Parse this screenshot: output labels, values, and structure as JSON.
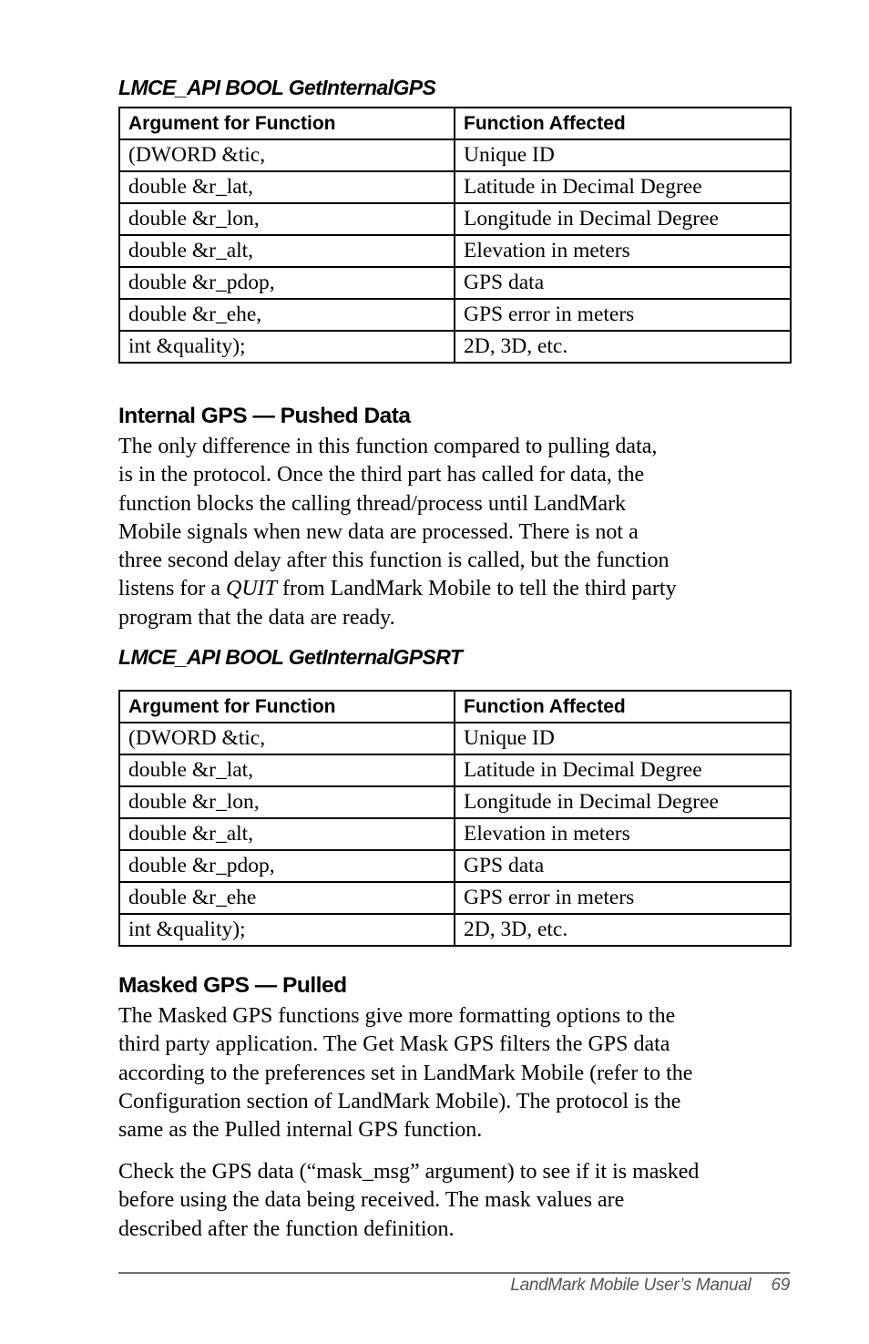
{
  "section1": {
    "function_title": "LMCE_API BOOL GetInternalGPS",
    "table": {
      "headers": [
        "Argument for Function",
        "Function Affected"
      ],
      "rows": [
        [
          "(DWORD &tic,",
          "Unique ID"
        ],
        [
          "double &r_lat,",
          "Latitude in Decimal Degree"
        ],
        [
          "double &r_lon,",
          "Longitude in Decimal Degree"
        ],
        [
          "double &r_alt,",
          "Elevation in meters"
        ],
        [
          "double &r_pdop,",
          "GPS data"
        ],
        [
          "double &r_ehe,",
          "GPS error in meters"
        ],
        [
          "int &quality);",
          "2D, 3D, etc."
        ]
      ]
    }
  },
  "section2": {
    "heading": "Internal GPS — Pushed Data",
    "paragraph_lines": [
      "The only difference in this function compared to pulling data,",
      "is in the protocol. Once the third part has called for data, the",
      "function blocks the calling thread/process until LandMark",
      "Mobile signals when new data are processed. There is not a",
      "three second delay after this function is called, but the function"
    ],
    "line6_before": "listens for a ",
    "line6_italic": "QUIT",
    "line6_after": " from LandMark Mobile to tell the third party",
    "line7": "program that the data are ready.",
    "function_title": "LMCE_API BOOL GetInternalGPSRT",
    "table": {
      "headers": [
        "Argument for Function",
        "Function Affected"
      ],
      "rows": [
        [
          "(DWORD &tic,",
          "Unique ID"
        ],
        [
          "double &r_lat,",
          "Latitude in Decimal Degree"
        ],
        [
          "double &r_lon,",
          "Longitude in Decimal Degree"
        ],
        [
          "double &r_alt,",
          "Elevation in meters"
        ],
        [
          "double &r_pdop,",
          "GPS data"
        ],
        [
          "double &r_ehe",
          "GPS error in meters"
        ],
        [
          "int &quality);",
          "2D, 3D, etc."
        ]
      ]
    }
  },
  "section3": {
    "heading": "Masked GPS — Pulled",
    "paragraph1_lines": [
      "The Masked GPS functions give more formatting options to the",
      "third party application. The Get Mask GPS filters the GPS data",
      "according to the preferences set in LandMark Mobile (refer to the",
      "Configuration section of LandMark Mobile). The protocol is the",
      "same as the Pulled internal GPS function."
    ],
    "paragraph2_lines": [
      "Check the GPS data (“mask_msg” argument) to see if it is masked",
      "before using the data being received. The mask values are",
      "described after the function definition."
    ]
  },
  "footer": {
    "manual_title": "LandMark Mobile User’s Manual",
    "page_number": "69"
  }
}
